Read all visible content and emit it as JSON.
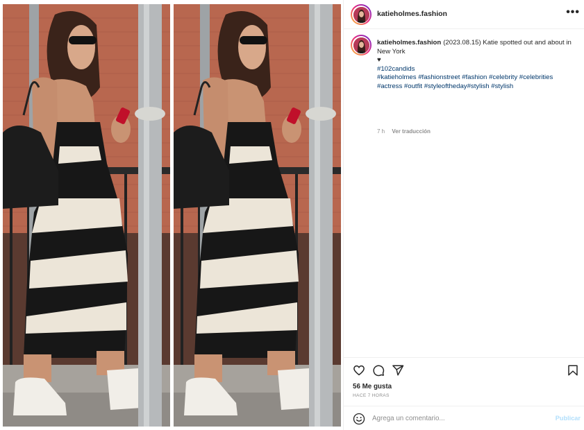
{
  "post": {
    "username": "katieholmes.fashion",
    "more_icon": "more-horizontal-icon",
    "more_glyph": "•••"
  },
  "caption": {
    "username": "katieholmes.fashion",
    "text": "(2023.08.15) Katie spotted out and about in New York",
    "heart": "♥",
    "line_tag": "#102candids",
    "tags_line1": "#katieholmes #fashionstreet #fashion #celebrity #celebrities",
    "tags_line2": "#actress #outfit #styleoftheday#stylish #stylish",
    "age": "7 h",
    "translate": "Ver traducción"
  },
  "actions": {
    "icons": [
      "heart-icon",
      "comment-icon",
      "share-icon",
      "bookmark-icon"
    ]
  },
  "likes": "56 Me gusta",
  "timestamp": "HACE 7 HORAS",
  "comment_box": {
    "placeholder": "Agrega un comentario...",
    "publish": "Publicar",
    "emoji_icon": "emoji-icon"
  },
  "colors": {
    "link": "#00376b",
    "publish_disabled": "#b2dffc",
    "muted": "#8e8e8e"
  }
}
